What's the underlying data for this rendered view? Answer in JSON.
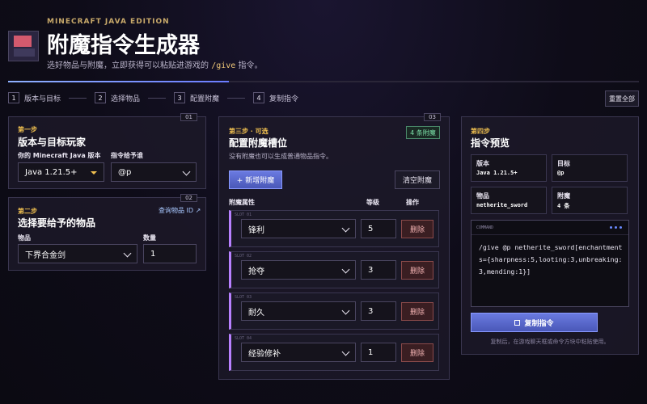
{
  "header": {
    "edition": "MINECRAFT JAVA EDITION",
    "title": "附魔指令生成器",
    "subtitle_pre": "选好物品与附魔，立即获得可以粘贴进游戏的 ",
    "subtitle_code": "/give",
    "subtitle_post": " 指令。",
    "progress_percent": 35
  },
  "steps": [
    {
      "num": "1",
      "label": "版本与目标"
    },
    {
      "num": "2",
      "label": "选择物品"
    },
    {
      "num": "3",
      "label": "配置附魔"
    },
    {
      "num": "4",
      "label": "复制指令"
    }
  ],
  "reset_label": "重置全部",
  "panel1": {
    "tag": "01",
    "step": "第一步",
    "title": "版本与目标玩家",
    "version_label": "你的 Minecraft Java 版本",
    "version_value": "Java 1.21.5+",
    "target_label": "指令给予谁",
    "target_value": "@p"
  },
  "panel2": {
    "tag": "02",
    "step": "第二步",
    "title": "选择要给予的物品",
    "lookup_link": "查询物品 ID ↗",
    "item_label": "物品",
    "item_value": "下界合金剑",
    "qty_label": "数量",
    "qty_value": "1"
  },
  "panel3": {
    "tag": "03",
    "step": "第三步 · 可选",
    "title": "配置附魔槽位",
    "desc": "没有附魔也可以生成普通物品指令。",
    "badge": "4 条附魔",
    "add_label": "+ 新增附魔",
    "clear_label": "清空附魔",
    "col_attr": "附魔属性",
    "col_level": "等级",
    "col_action": "操作",
    "delete_label": "删除",
    "slots": [
      {
        "id": "SLOT 01",
        "name": "锋利",
        "level": "5"
      },
      {
        "id": "SLOT 02",
        "name": "抢夺",
        "level": "3"
      },
      {
        "id": "SLOT 03",
        "name": "耐久",
        "level": "3"
      },
      {
        "id": "SLOT 04",
        "name": "经验修补",
        "level": "1"
      }
    ]
  },
  "panel4": {
    "step": "第四步",
    "title": "指令预览",
    "version_k": "版本",
    "version_v": "Java 1.21.5+",
    "target_k": "目标",
    "target_v": "@p",
    "item_k": "物品",
    "item_v": "netherite_sword",
    "ench_k": "附魔",
    "ench_v": "4 条",
    "cmd_caption": "COMMAND",
    "command": "/give @p netherite_sword[enchantments={sharpness:5,looting:3,unbreaking:3,mending:1}]",
    "copy_label": "复制指令",
    "hint": "复制后，在游戏聊天框或命令方块中粘贴使用。"
  }
}
